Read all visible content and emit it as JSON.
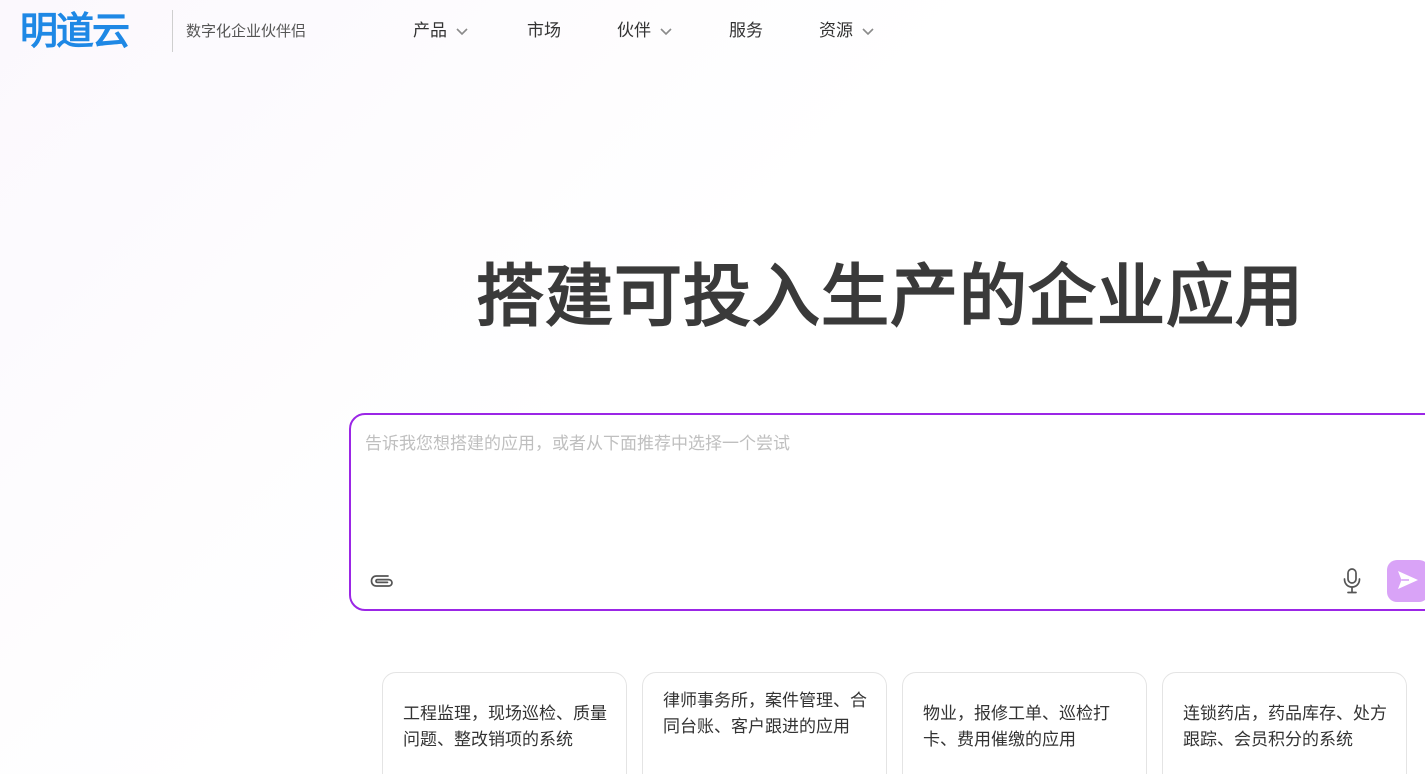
{
  "header": {
    "logo": "明道云",
    "slogan": "数字化企业伙伴侣",
    "nav": [
      {
        "label": "产品",
        "has_dropdown": true
      },
      {
        "label": "市场",
        "has_dropdown": false
      },
      {
        "label": "伙伴",
        "has_dropdown": true
      },
      {
        "label": "服务",
        "has_dropdown": false
      },
      {
        "label": "资源",
        "has_dropdown": true
      }
    ]
  },
  "hero": {
    "title": "搭建可投入生产的企业应用"
  },
  "prompt": {
    "placeholder": "告诉我您想搭建的应用，或者从下面推荐中选择一个尝试",
    "value": ""
  },
  "icons": {
    "attach": "paperclip-icon",
    "mic": "microphone-icon",
    "send": "send-icon"
  },
  "colors": {
    "brand": "#1e88e5",
    "prompt_border": "#9b26e6",
    "send_button": "#d9a3f7"
  },
  "suggestions": [
    {
      "text": "工程监理，现场巡检、质量问题、整改销项的系统"
    },
    {
      "text": "律师事务所，案件管理、合同台账、客户跟进的应用"
    },
    {
      "text": "物业，报修工单、巡检打卡、费用催缴的应用"
    },
    {
      "text": "连锁药店，药品库存、处方跟踪、会员积分的系统"
    }
  ]
}
